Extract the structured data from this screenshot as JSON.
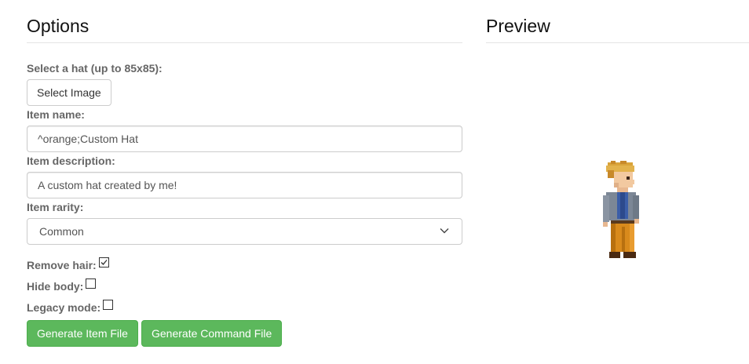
{
  "options": {
    "heading": "Options",
    "hat_label": "Select a hat (up to 85x85):",
    "select_image_label": "Select Image",
    "item_name_label": "Item name:",
    "item_name_value": "^orange;Custom Hat",
    "item_description_label": "Item description:",
    "item_description_value": "A custom hat created by me!",
    "item_rarity_label": "Item rarity:",
    "item_rarity_value": "Common",
    "remove_hair_label": "Remove hair:",
    "remove_hair_checked": true,
    "hide_body_label": "Hide body:",
    "hide_body_checked": false,
    "legacy_mode_label": "Legacy mode:",
    "legacy_mode_checked": false,
    "generate_item_label": "Generate Item File",
    "generate_command_label": "Generate Command File"
  },
  "preview": {
    "heading": "Preview"
  },
  "colors": {
    "success": "#5cb85c",
    "label_gray": "#666666"
  }
}
